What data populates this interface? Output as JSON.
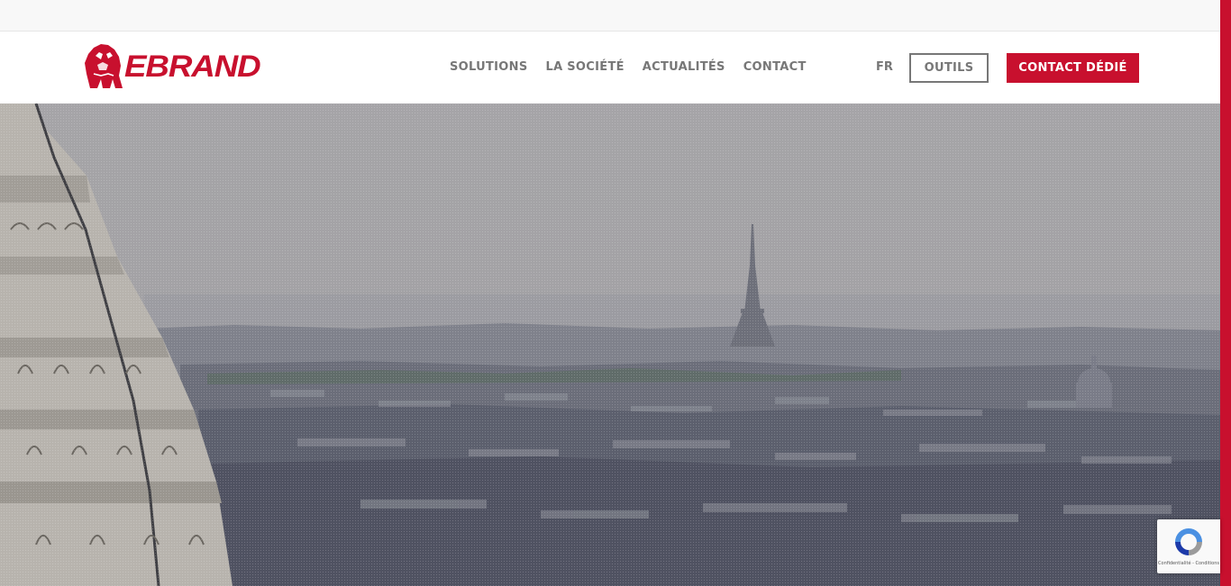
{
  "brand": {
    "name": "EBRAND",
    "color": "#c8102e"
  },
  "nav": {
    "items": [
      {
        "label": "SOLUTIONS"
      },
      {
        "label": "LA SOCIÉTÉ"
      },
      {
        "label": "ACTUALITÉS"
      },
      {
        "label": "CONTACT"
      }
    ]
  },
  "header": {
    "lang": "FR",
    "tools_label": "OUTILS",
    "contact_label": "CONTACT DÉDIÉ"
  },
  "hero": {
    "image": "paris-skyline-eiffel-tower-photo"
  },
  "recaptcha": {
    "icon": "recaptcha-icon",
    "text": "Confidentialité - Conditions"
  }
}
